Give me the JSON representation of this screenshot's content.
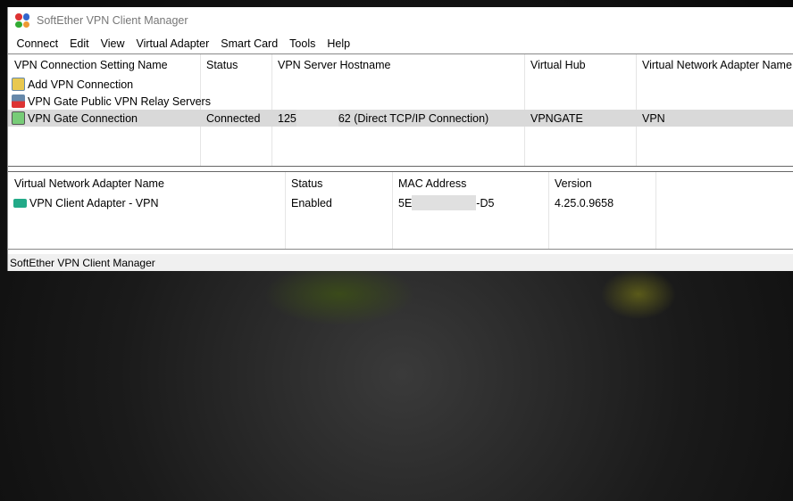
{
  "window": {
    "title": "SoftEther VPN Client Manager"
  },
  "menu": [
    "Connect",
    "Edit",
    "View",
    "Virtual Adapter",
    "Smart Card",
    "Tools",
    "Help"
  ],
  "connections": {
    "headers": [
      "VPN Connection Setting Name",
      "Status",
      "VPN Server Hostname",
      "Virtual Hub",
      "Virtual Network Adapter Name"
    ],
    "rows": [
      {
        "name": "Add VPN Connection",
        "icon": "add-connection-icon"
      },
      {
        "name": "VPN Gate Public VPN Relay Servers",
        "icon": "vpn-gate-icon"
      },
      {
        "name": "VPN Gate Connection",
        "icon": "connection-icon",
        "status": "Connected",
        "host_prefix": "125",
        "host_suffix": "62 (Direct TCP/IP Connection)",
        "hub": "VPNGATE",
        "adapter": "VPN"
      }
    ]
  },
  "adapters": {
    "headers": [
      "Virtual Network Adapter Name",
      "Status",
      "MAC Address",
      "Version"
    ],
    "rows": [
      {
        "name": "VPN Client Adapter - VPN",
        "status": "Enabled",
        "mac_prefix": "5E",
        "mac_suffix": "-D5",
        "version": "4.25.0.9658"
      }
    ]
  },
  "statusbar": "SoftEther VPN Client Manager"
}
